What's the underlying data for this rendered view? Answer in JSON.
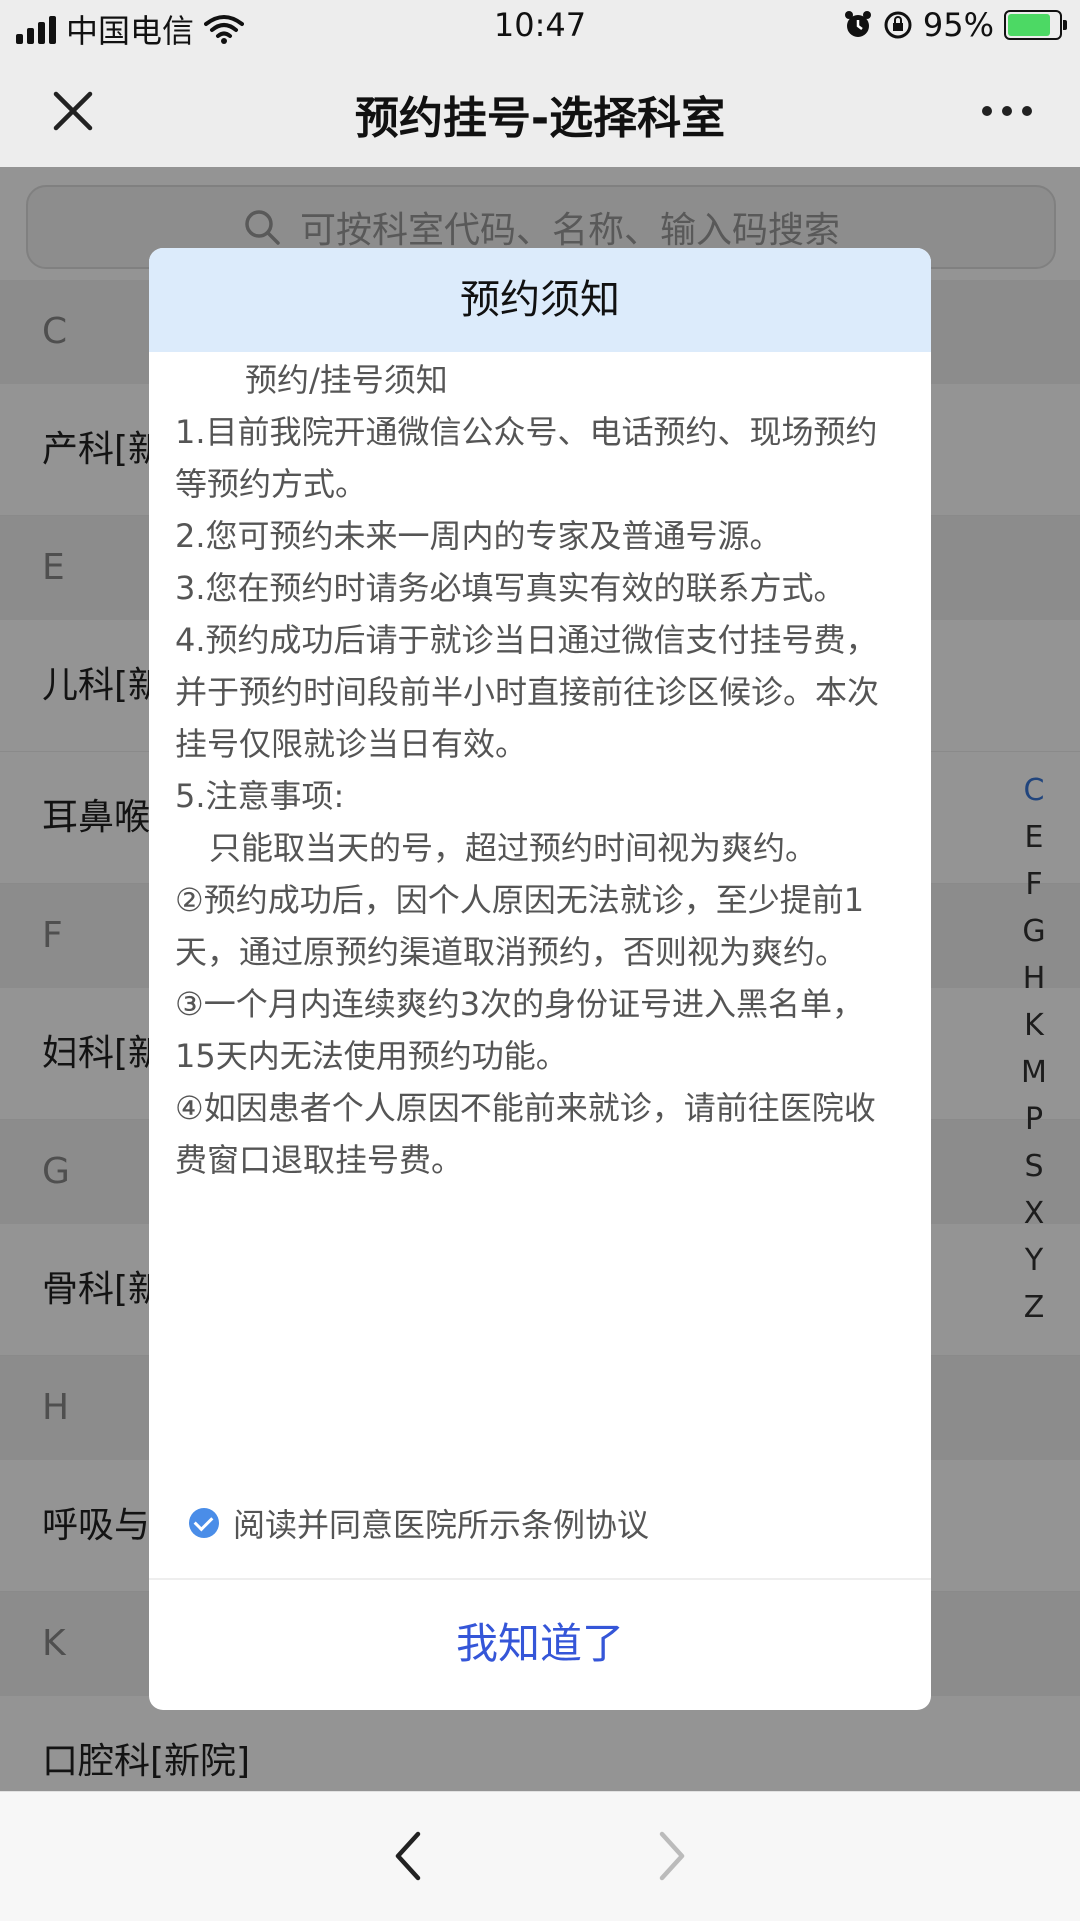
{
  "status_bar": {
    "carrier": "中国电信",
    "time": "10:47",
    "battery": "95%"
  },
  "title_bar": {
    "title": "预约挂号-选择科室"
  },
  "search": {
    "placeholder": "可按科室代码、名称、输入码搜索"
  },
  "list": {
    "groups": [
      {
        "letter": "C",
        "items": [
          "产科[新"
        ]
      },
      {
        "letter": "E",
        "items": [
          "儿科[新",
          "耳鼻喉"
        ]
      },
      {
        "letter": "F",
        "items": [
          "妇科[新"
        ]
      },
      {
        "letter": "G",
        "items": [
          "骨科[新"
        ]
      },
      {
        "letter": "H",
        "items": [
          "呼吸与"
        ]
      },
      {
        "letter": "K",
        "items": [
          "口腔科[新院]"
        ]
      }
    ]
  },
  "index_bar": [
    "C",
    "E",
    "F",
    "G",
    "H",
    "K",
    "M",
    "P",
    "S",
    "X",
    "Y",
    "Z"
  ],
  "modal": {
    "title": "预约须知",
    "sub_title": "预约/挂号须知",
    "lines": [
      "1.目前我院开通微信公众号、电话预约、现场预约等预约方式。",
      "2.您可预约未来一周内的专家及普通号源。",
      "3.您在预约时请务必填写真实有效的联系方式。",
      "4.预约成功后请于就诊当日通过微信支付挂号费，并于预约时间段前半小时直接前往诊区候诊。本次挂号仅限就诊当日有效。",
      "5.注意事项:"
    ],
    "note_indent": "只能取当天的号，超过预约时间视为爽约。",
    "notes": [
      "②预约成功后，因个人原因无法就诊，至少提前1天，通过原预约渠道取消预约，否则视为爽约。",
      "③一个月内连续爽约3次的身份证号进入黑名单，15天内无法使用预约功能。",
      "④如因患者个人原因不能前来就诊，请前往医院收费窗口退取挂号费。"
    ],
    "agree_label": "阅读并同意医院所示条例协议",
    "confirm_label": "我知道了"
  }
}
